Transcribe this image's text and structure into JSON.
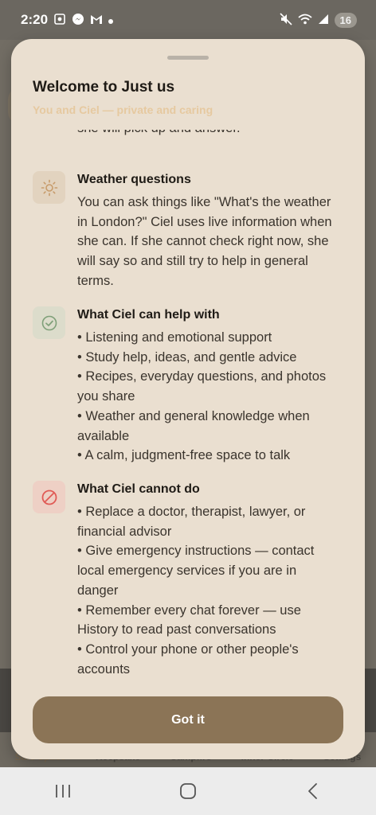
{
  "status_bar": {
    "time": "2:20",
    "battery": "16"
  },
  "background_tabs": [
    "Safe Space",
    "Keepsake",
    "Campfire",
    "Inner Circle",
    "Settings"
  ],
  "sheet": {
    "title": "Welcome to Just us",
    "subtitle": "You and Ciel — private and caring",
    "partial_line": "she will pick up and answer.",
    "sections": [
      {
        "title": "Weather questions",
        "text": "You can ask things like \"What's the weather in London?\" Ciel uses live information when she can. If she cannot check right now, she will say so and still try to help in general terms.",
        "icon": "sun-icon",
        "icon_color": "#c79b6a",
        "icon_bg": "#e2d3bf"
      },
      {
        "title": "What Ciel can help with",
        "text": "• Listening and emotional support\n• Study help, ideas, and gentle advice\n• Recipes, everyday questions, and photos you share\n• Weather and general knowledge when available\n• A calm, judgment-free space to talk",
        "icon": "check-circle-icon",
        "icon_color": "#7fa079",
        "icon_bg": "#dcdccb"
      },
      {
        "title": "What Ciel cannot do",
        "text": "• Replace a doctor, therapist, lawyer, or financial advisor\n• Give emergency instructions — contact local emergency services if you are in danger\n• Remember every chat forever — use History to read past conversations\n• Control your phone or other people's accounts",
        "icon": "block-icon",
        "icon_color": "#e05a55",
        "icon_bg": "#eed0c5"
      }
    ],
    "button_label": "Got it"
  },
  "colors": {
    "sheet_bg": "#eadfd0",
    "button_bg": "#8b7456",
    "subtitle": "#e6c9a0"
  }
}
